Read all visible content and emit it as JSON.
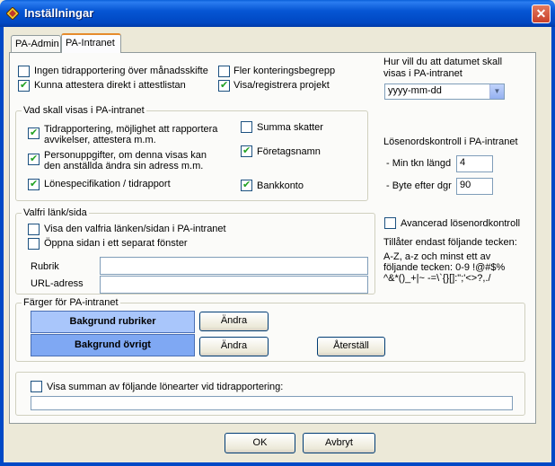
{
  "window": {
    "title": "Inställningar",
    "close_symbol": "✕"
  },
  "tabs": [
    {
      "label": "PA-Admin"
    },
    {
      "label": "PA-Intranet"
    }
  ],
  "top_options": {
    "no_timereport": {
      "label": "Ingen tidrapportering över månadsskifte",
      "checked": false
    },
    "attest_direct": {
      "label": "Kunna attestera direkt i attestlistan",
      "checked": true
    },
    "more_accounting": {
      "label": "Fler konteringsbegrepp",
      "checked": false
    },
    "show_project": {
      "label": "Visa/registrera projekt",
      "checked": true
    }
  },
  "date_format": {
    "question": "Hur vill du att datumet skall visas i PA-intranet",
    "selected": "yyyy-mm-dd"
  },
  "show_group": {
    "legend": "Vad skall visas i PA-intranet",
    "timereport": {
      "label": "Tidrapportering, möjlighet att rapportera avvikelser, attestera m.m.",
      "checked": true
    },
    "personal": {
      "label": "Personuppgifter, om denna visas kan den anställda ändra sin adress m.m.",
      "checked": true
    },
    "payslip": {
      "label": "Lönespecifikation / tidrapport",
      "checked": true
    },
    "tax_sum": {
      "label": "Summa skatter",
      "checked": false
    },
    "company": {
      "label": "Företagsnamn",
      "checked": true
    },
    "bank": {
      "label": "Bankkonto",
      "checked": true
    }
  },
  "password": {
    "heading": "Lösenordskontroll i PA-intranet",
    "min_length_label": "- Min tkn längd",
    "min_length_value": "4",
    "change_after_label": "- Byte efter dgr",
    "change_after_value": "90",
    "advanced": {
      "label": "Avancerad lösenordkontroll",
      "checked": false
    },
    "allowed_text": "Tillåter endast följande tecken:",
    "rules_text": "A-Z, a-z och minst ett av följande tecken: 0-9 !@#$% ^&*()_+|~ -=\\`{}[]:\";'<>?,./"
  },
  "link_group": {
    "legend": "Valfri länk/sida",
    "show_link": {
      "label": "Visa den valfria länken/sidan i PA-intranet",
      "checked": false
    },
    "open_separate": {
      "label": "Öppna sidan i ett separat fönster",
      "checked": false
    },
    "title_label": "Rubrik",
    "title_value": "",
    "url_label": "URL-adress",
    "url_value": ""
  },
  "colors_group": {
    "legend": "Färger för PA-intranet",
    "header_bg_label": "Bakgrund rubriker",
    "header_bg_color": "#a9c6fb",
    "other_bg_label": "Bakgrund övrigt",
    "other_bg_color": "#7fa8f3",
    "change_label": "Ändra",
    "reset_label": "Återställ"
  },
  "salary_types": {
    "label": "Visa summan av följande lönearter vid tidrapportering:",
    "checked": false,
    "value": ""
  },
  "footer": {
    "ok_label": "OK",
    "cancel_label": "Avbryt"
  }
}
